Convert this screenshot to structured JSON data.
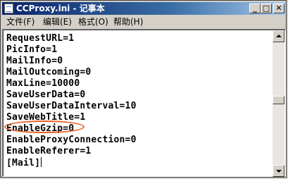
{
  "window": {
    "title": "CCProxy.ini - 记事本",
    "controls": {
      "minimize": "_",
      "maximize": "□",
      "close": "✕"
    }
  },
  "menu": [
    {
      "label": "文件(F)"
    },
    {
      "label": "编辑(E)"
    },
    {
      "label": "格式(O)"
    },
    {
      "label": "帮助(H)"
    }
  ],
  "editor": {
    "lines": [
      "RequestURL=1",
      "PicInfo=1",
      "MailInfo=0",
      "MailOutcoming=0",
      "MaxLine=10000",
      "SaveUserData=0",
      "SaveUserDataInterval=10",
      "SaveWebTitle=1",
      "EnableGzip=0",
      "EnableProxyConnection=0",
      "EnableReferer=1",
      "[Mail]"
    ],
    "highlighted_line": "EnableGzip=0",
    "highlight_color": "#e8622a"
  },
  "colors": {
    "titlebar_start": "#0a246a",
    "titlebar_end": "#a6caf0",
    "chrome": "#d4d0c8"
  }
}
